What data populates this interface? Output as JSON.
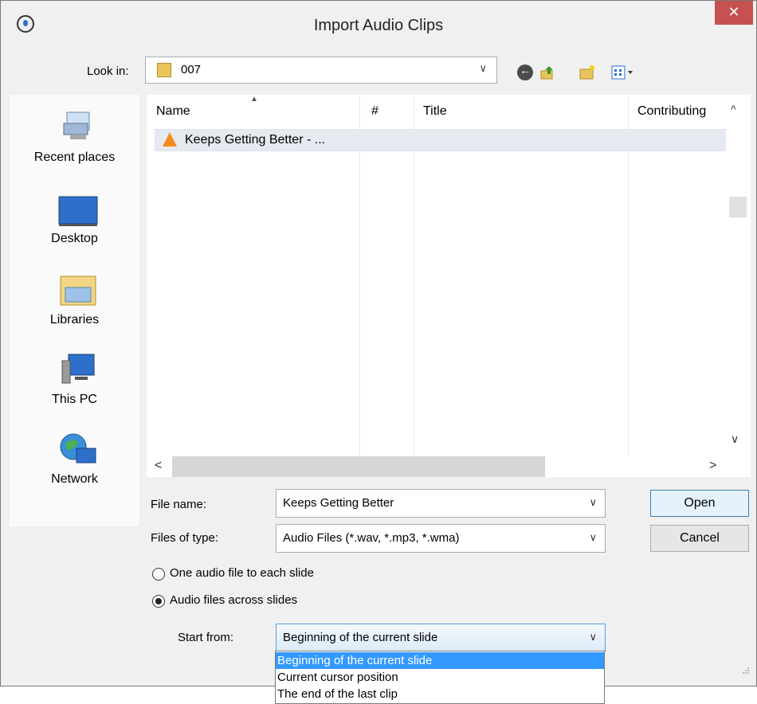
{
  "window": {
    "title": "Import Audio Clips",
    "close_glyph": "✕",
    "app_icon": "timer-icon"
  },
  "look_in": {
    "label": "Look in:",
    "value": "007",
    "arrow": "∨"
  },
  "toolbar_icons": [
    "back-icon",
    "up-folder-icon",
    "new-folder-icon",
    "view-menu-icon"
  ],
  "places": [
    {
      "label": "Recent places",
      "icon": "recent-places-icon"
    },
    {
      "label": "Desktop",
      "icon": "desktop-icon"
    },
    {
      "label": "Libraries",
      "icon": "libraries-icon"
    },
    {
      "label": "This PC",
      "icon": "this-pc-icon"
    },
    {
      "label": "Network",
      "icon": "network-icon"
    }
  ],
  "file_list": {
    "columns": [
      "Name",
      "#",
      "Title",
      "Contributing"
    ],
    "rows": [
      {
        "name": "Keeps Getting Better - ...",
        "icon": "vlc-cone-icon"
      }
    ],
    "scroll_up": "^",
    "scroll_down": "∨",
    "scroll_left": "<",
    "scroll_right": ">"
  },
  "file_name": {
    "label": "File name:",
    "value": "Keeps Getting Better"
  },
  "files_of_type": {
    "label": "Files of type:",
    "value": "Audio Files (*.wav, *.mp3, *.wma)"
  },
  "buttons": {
    "open": "Open",
    "cancel": "Cancel"
  },
  "radios": [
    {
      "label": "One audio file to each slide",
      "checked": false
    },
    {
      "label": "Audio files across slides",
      "checked": true
    }
  ],
  "start_from": {
    "label": "Start from:",
    "value": "Beginning of the current slide",
    "options": [
      "Beginning of the current slide",
      "Current cursor position",
      "The end of the last clip"
    ],
    "selected_index": 0
  },
  "colors": {
    "selection": "#3399ff",
    "close": "#c75050",
    "folder": "#e9c45a"
  }
}
